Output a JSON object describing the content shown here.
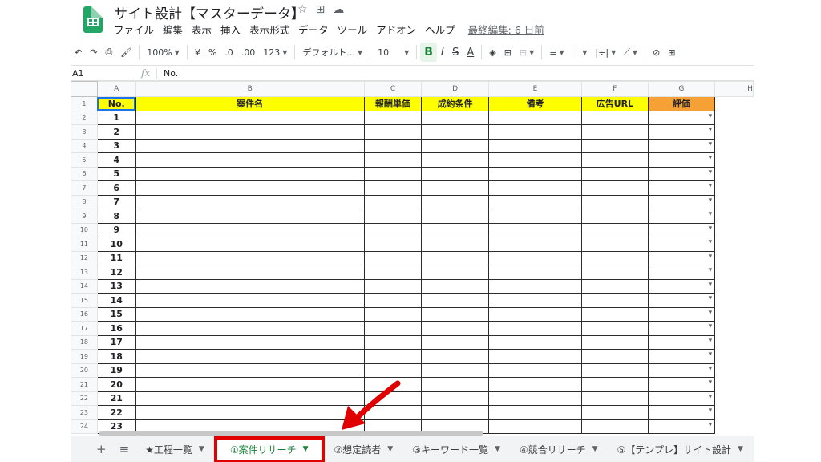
{
  "doc": {
    "title": "サイト設計【マスターデータ】",
    "icons": [
      "star-icon",
      "move-to-folder-icon",
      "cloud-saved-icon"
    ]
  },
  "menu": {
    "items": [
      "ファイル",
      "編集",
      "表示",
      "挿入",
      "表示形式",
      "データ",
      "ツール",
      "アドオン",
      "ヘルプ"
    ],
    "last_edit": "最終編集: 6 日前"
  },
  "toolbar": {
    "zoom": "100%",
    "currency": "¥",
    "percent": "%",
    "dec_decrease": ".0",
    "dec_increase": ".00",
    "format_more": "123",
    "font": "デフォルト...",
    "font_size": "10",
    "bold": "B",
    "italic": "I",
    "strike": "S",
    "text_color": "A"
  },
  "formula_bar": {
    "name_box": "A1",
    "fx": "fx",
    "value": "No."
  },
  "grid": {
    "columns": [
      "A",
      "B",
      "C",
      "D",
      "E",
      "F",
      "G",
      "H"
    ],
    "headers": [
      "No.",
      "案件名",
      "報酬単価",
      "成約条件",
      "備考",
      "広告URL",
      "評価"
    ],
    "row_numbers": [
      "1",
      "2",
      "3",
      "4",
      "5",
      "6",
      "7",
      "8",
      "9",
      "10",
      "11",
      "12",
      "13",
      "14",
      "15",
      "16",
      "17",
      "18",
      "19",
      "20",
      "21",
      "22",
      "23",
      "24"
    ],
    "numbers": [
      "1",
      "2",
      "3",
      "4",
      "5",
      "6",
      "7",
      "8",
      "9",
      "10",
      "11",
      "12",
      "13",
      "14",
      "15",
      "16",
      "17",
      "18",
      "19",
      "20",
      "21",
      "22",
      "23"
    ],
    "colors": {
      "header_bg": "#ffff00",
      "eval_header_bg": "#f6a135"
    }
  },
  "tabs": {
    "add_icon": "+",
    "list_icon": "≡",
    "items": [
      {
        "label": "★工程一覧",
        "active": false
      },
      {
        "label": "①案件リサーチ",
        "active": true
      },
      {
        "label": "②想定読者",
        "active": false
      },
      {
        "label": "③キーワード一覧",
        "active": false
      },
      {
        "label": "④競合リサーチ",
        "active": false
      },
      {
        "label": "⑤【テンプレ】サイト設計",
        "active": false
      }
    ],
    "colors": {
      "active_text": "#188038",
      "highlight_box": "#e00000"
    }
  }
}
